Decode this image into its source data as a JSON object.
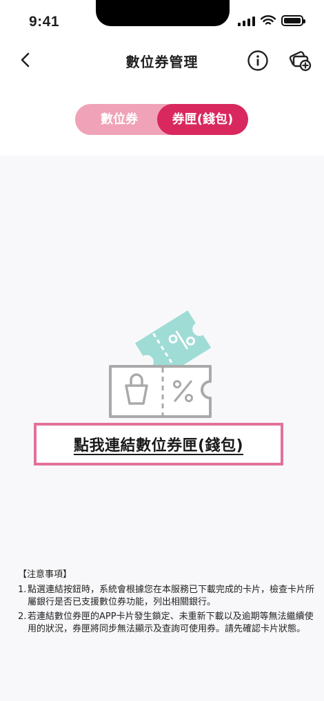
{
  "status_bar": {
    "time": "9:41"
  },
  "nav": {
    "title": "數位券管理"
  },
  "segment": {
    "left_label": "數位券",
    "right_label": "券匣(錢包)"
  },
  "main": {
    "link_text": "點我連結數位券匣(錢包)"
  },
  "notes": {
    "heading": "【注意事項】",
    "items": [
      {
        "num": "1.",
        "text": "點選連結按鈕時，系統會根據您在本服務已下載完成的卡片，檢查卡片所屬銀行是否已支援數位券功能，列出相關銀行。"
      },
      {
        "num": "2.",
        "text": "若連結數位券匣的APP卡片發生鎖定、未重新下載以及逾期等無法繼續使用的狀況，券匣將同步無法顯示及查詢可使用券。請先確認卡片狀態。"
      }
    ]
  },
  "colors": {
    "accent": "#d8285e",
    "accent_light": "#f0a3b8",
    "highlight_border": "#e2719a",
    "ticket_teal": "#9fdcd6",
    "ticket_gray": "#a9a9a9"
  },
  "icons": {
    "back": "chevron-left-icon",
    "info": "info-icon",
    "card_add": "card-add-icon",
    "illustration": "ticket-wallet-icon"
  }
}
